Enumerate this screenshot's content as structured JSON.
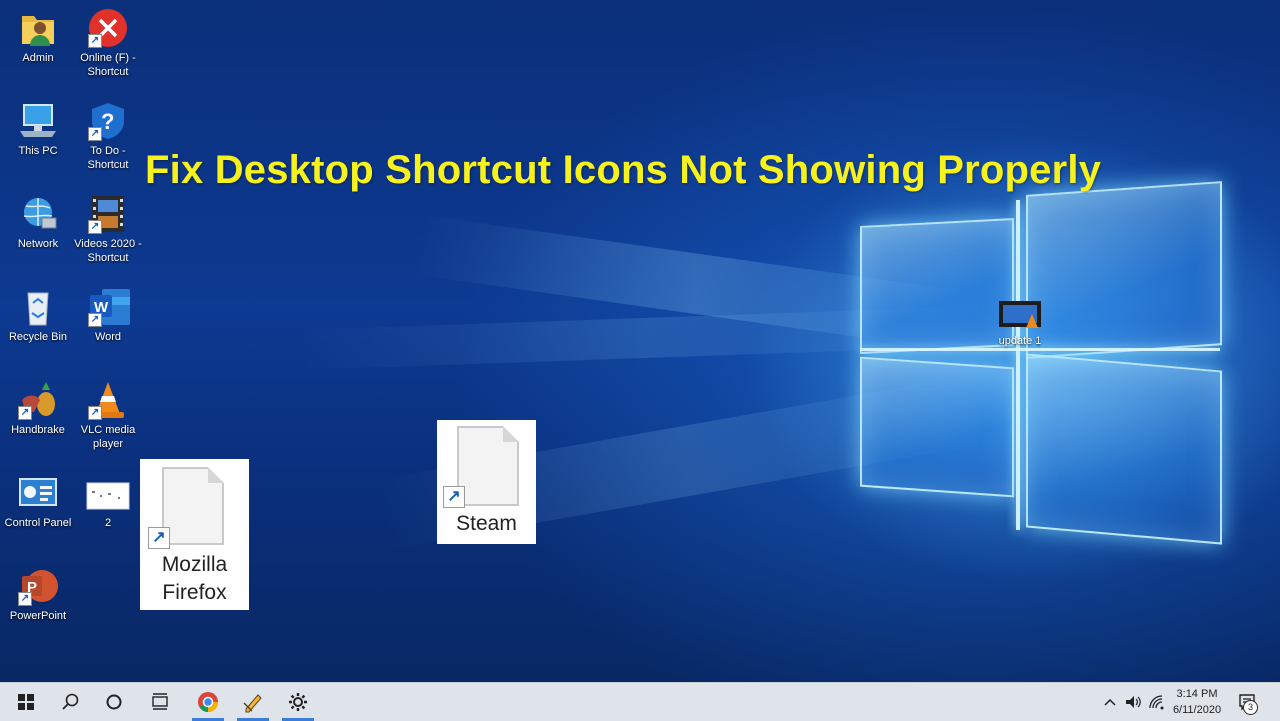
{
  "headline": "Fix Desktop Shortcut Icons Not Showing Properly",
  "desktop_icons": {
    "admin": "Admin",
    "online_f": "Online (F) - Shortcut",
    "this_pc": "This PC",
    "todo": "To Do - Shortcut",
    "network": "Network",
    "videos": "Videos 2020 - Shortcut",
    "recycle_bin": "Recycle Bin",
    "word": "Word",
    "handbrake": "Handbrake",
    "vlc": "VLC media player",
    "control_panel": "Control Panel",
    "item_2": "2",
    "powerpoint": "PowerPoint",
    "update": "update 1"
  },
  "broken_shortcuts": {
    "firefox_line1": "Mozilla",
    "firefox_line2": "Firefox",
    "steam": "Steam"
  },
  "taskbar": {
    "time": "3:14 PM",
    "date": "6/11/2020",
    "notification_count": "3"
  },
  "colors": {
    "headline": "#f7f21c",
    "taskbar": "#dfe3ea",
    "accent": "#3b7dd8"
  }
}
